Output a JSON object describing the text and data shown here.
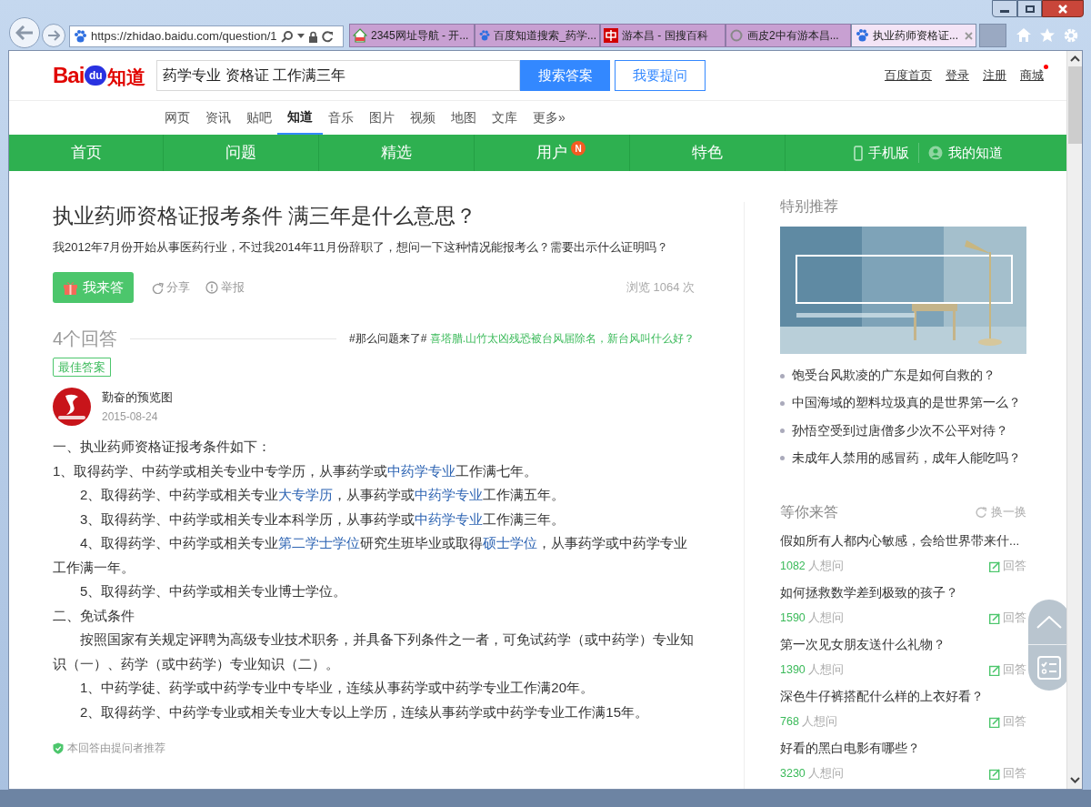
{
  "browser": {
    "url": "https://zhidao.baidu.com/question/1",
    "tabs": [
      {
        "title": "2345网址导航 - 开...",
        "selected": false
      },
      {
        "title": "百度知道搜索_药学...",
        "selected": false
      },
      {
        "title": "游本昌 - 国搜百科",
        "selected": false
      },
      {
        "title": "画皮2中有游本昌...",
        "selected": false
      },
      {
        "title": "执业药师资格证...",
        "selected": true
      }
    ]
  },
  "header": {
    "logo": {
      "left": "Bai",
      "mid": "du",
      "right": "知道"
    },
    "search": {
      "value": "药学专业 资格证 工作满三年"
    },
    "search_button": "搜索答案",
    "ask_button": "我要提问",
    "links": [
      {
        "label": "百度首页",
        "badge": false
      },
      {
        "label": "登录",
        "badge": false
      },
      {
        "label": "注册",
        "badge": false
      },
      {
        "label": "商城",
        "badge": true
      }
    ]
  },
  "nav": [
    {
      "label": "网页",
      "selected": false
    },
    {
      "label": "资讯",
      "selected": false
    },
    {
      "label": "贴吧",
      "selected": false
    },
    {
      "label": "知道",
      "selected": true
    },
    {
      "label": "音乐",
      "selected": false
    },
    {
      "label": "图片",
      "selected": false
    },
    {
      "label": "视频",
      "selected": false
    },
    {
      "label": "地图",
      "selected": false
    },
    {
      "label": "文库",
      "selected": false
    },
    {
      "label": "更多»",
      "selected": false
    }
  ],
  "menu": {
    "items": [
      {
        "label": "首页"
      },
      {
        "label": "问题"
      },
      {
        "label": "精选"
      },
      {
        "label": "用户",
        "badge": "N"
      },
      {
        "label": "特色"
      }
    ],
    "right": [
      {
        "label": "手机版"
      },
      {
        "label": "我的知道"
      }
    ]
  },
  "question": {
    "title": "执业药师资格证报考条件 满三年是什么意思？",
    "description": "我2012年7月份开始从事医药行业，不过我2014年11月份辞职了，想问一下这种情况能报考么？需要出示什么证明吗？",
    "answer_button": "我来答",
    "share": "分享",
    "report": "举报",
    "views": "浏览 1064 次"
  },
  "answers": {
    "count": "4个回答",
    "hashtag": "#那么问题来了#",
    "promo": "喜塔腊.山竹太凶残恐被台风届除名，新台风叫什么好？"
  },
  "best_answer": {
    "tag": "最佳答案",
    "user": "勤奋的预览图",
    "date": "2015-08-24",
    "paragraphs": [
      {
        "indent": false,
        "parts": [
          {
            "text": "一、执业药师资格证报考条件如下：",
            "kind": "text"
          }
        ]
      },
      {
        "indent": false,
        "parts": [
          {
            "text": "1、取得药学、中药学或相关专业中专学历，从事药学或",
            "kind": "text"
          },
          {
            "text": "中药学专业",
            "kind": "link"
          },
          {
            "text": "工作满七年。",
            "kind": "text"
          }
        ]
      },
      {
        "indent": true,
        "parts": [
          {
            "text": "2、取得药学、中药学或相关专业",
            "kind": "text"
          },
          {
            "text": "大专学历",
            "kind": "link"
          },
          {
            "text": "，从事药学或",
            "kind": "text"
          },
          {
            "text": "中药学专业",
            "kind": "link"
          },
          {
            "text": "工作满五年。",
            "kind": "text"
          }
        ]
      },
      {
        "indent": true,
        "parts": [
          {
            "text": "3、取得药学、中药学或相关专业本科学历，从事药学或",
            "kind": "text"
          },
          {
            "text": "中药学专业",
            "kind": "link"
          },
          {
            "text": "工作满三年。",
            "kind": "text"
          }
        ]
      },
      {
        "indent": true,
        "parts": [
          {
            "text": "4、取得药学、中药学或相关专业",
            "kind": "text"
          },
          {
            "text": "第二学士学位",
            "kind": "link"
          },
          {
            "text": "研究生班毕业或取得",
            "kind": "text"
          },
          {
            "text": "硕士学位",
            "kind": "link"
          },
          {
            "text": "，从事药学或中药学专业工作满一年。",
            "kind": "text"
          }
        ]
      },
      {
        "indent": true,
        "parts": [
          {
            "text": "5、取得药学、中药学或相关专业博士学位。",
            "kind": "text"
          }
        ]
      },
      {
        "indent": false,
        "parts": [
          {
            "text": "二、免试条件",
            "kind": "text"
          }
        ]
      },
      {
        "indent": true,
        "parts": [
          {
            "text": "按照国家有关规定评聘为高级专业技术职务，并具备下列条件之一者，可免试药学（或中药学）专业知识（一）、药学（或中药学）专业知识（二）。",
            "kind": "text"
          }
        ]
      },
      {
        "indent": true,
        "parts": [
          {
            "text": "1、中药学徒、药学或中药学专业中专毕业，连续从事药学或中药学专业工作满20年。",
            "kind": "text"
          }
        ]
      },
      {
        "indent": true,
        "parts": [
          {
            "text": "2、取得药学、中药学专业或相关专业大专以上学历，连续从事药学或中药学专业工作满15年。",
            "kind": "text"
          }
        ]
      }
    ],
    "note": "本回答由提问者推荐"
  },
  "sidebar": {
    "special": {
      "title": "特别推荐",
      "items": [
        "饱受台风欺凌的广东是如何自救的？",
        "中国海域的塑料垃圾真的是世界第一么？",
        "孙悟空受到过唐僧多少次不公平对待？",
        "未成年人禁用的感冒药，成年人能吃吗？"
      ]
    },
    "waiting": {
      "title": "等你来答",
      "refresh": "换一换",
      "questions": [
        {
          "title": "假如所有人都内心敏感，会给世界带来什...",
          "count": "1082",
          "suffix": "人想问",
          "action": "回答"
        },
        {
          "title": "如何拯救数学差到极致的孩子？",
          "count": "1590",
          "suffix": "人想问",
          "action": "回答"
        },
        {
          "title": "第一次见女朋友送什么礼物？",
          "count": "1390",
          "suffix": "人想问",
          "action": "回答"
        },
        {
          "title": "深色牛仔裤搭配什么样的上衣好看？",
          "count": "768",
          "suffix": "人想问",
          "action": "回答"
        },
        {
          "title": "好看的黑白电影有哪些？",
          "count": "3230",
          "suffix": "人想问",
          "action": "回答"
        }
      ]
    }
  }
}
